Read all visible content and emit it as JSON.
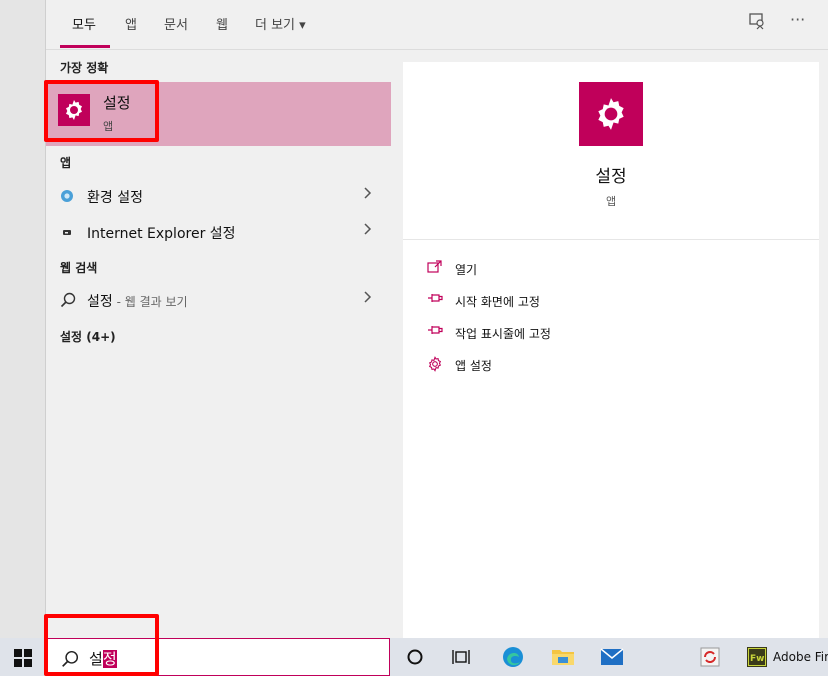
{
  "tabs": [
    {
      "label": "모두"
    },
    {
      "label": "앱"
    },
    {
      "label": "문서"
    },
    {
      "label": "웹"
    },
    {
      "label": "더 보기 ▾"
    }
  ],
  "toolbar": {
    "more_glyph": "···"
  },
  "sections": {
    "best_match": "가장 정확",
    "apps": "앱",
    "web": "웹 검색",
    "settings_count": "설정 (4+)"
  },
  "best_match": {
    "name": "설정",
    "type": "앱"
  },
  "app_results": [
    {
      "label": "환경 설정"
    },
    {
      "label": "Internet Explorer 설정"
    }
  ],
  "web_result": {
    "label": "설정",
    "sub": " - 웹 결과 보기"
  },
  "detail": {
    "name": "설정",
    "type": "앱",
    "actions": [
      {
        "label": "열기",
        "icon": "open-icon"
      },
      {
        "label": "시작 화면에 고정",
        "icon": "pin-icon"
      },
      {
        "label": "작업 표시줄에 고정",
        "icon": "pin-icon"
      },
      {
        "label": "앱 설정",
        "icon": "gear-icon"
      }
    ]
  },
  "search": {
    "typed": "설",
    "composing": "정"
  },
  "taskbar": {
    "fireworks_label": "Adobe Fire"
  },
  "colors": {
    "accent": "#c0005a",
    "highlight": "#dfa5bd",
    "annotation": "#ff0000"
  }
}
